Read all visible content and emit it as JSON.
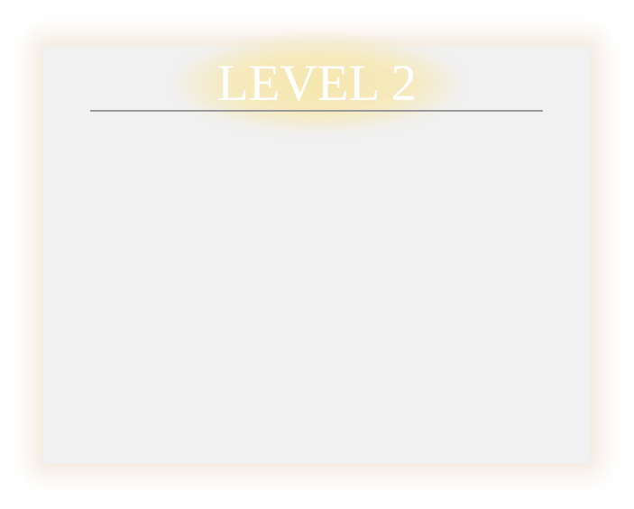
{
  "level": {
    "title": "LEVEL 2"
  },
  "colors": {
    "panel": "#f1f1f1",
    "glow": "#f6e6aa",
    "title": "#ffffff",
    "divider": "#9a9a9a"
  }
}
